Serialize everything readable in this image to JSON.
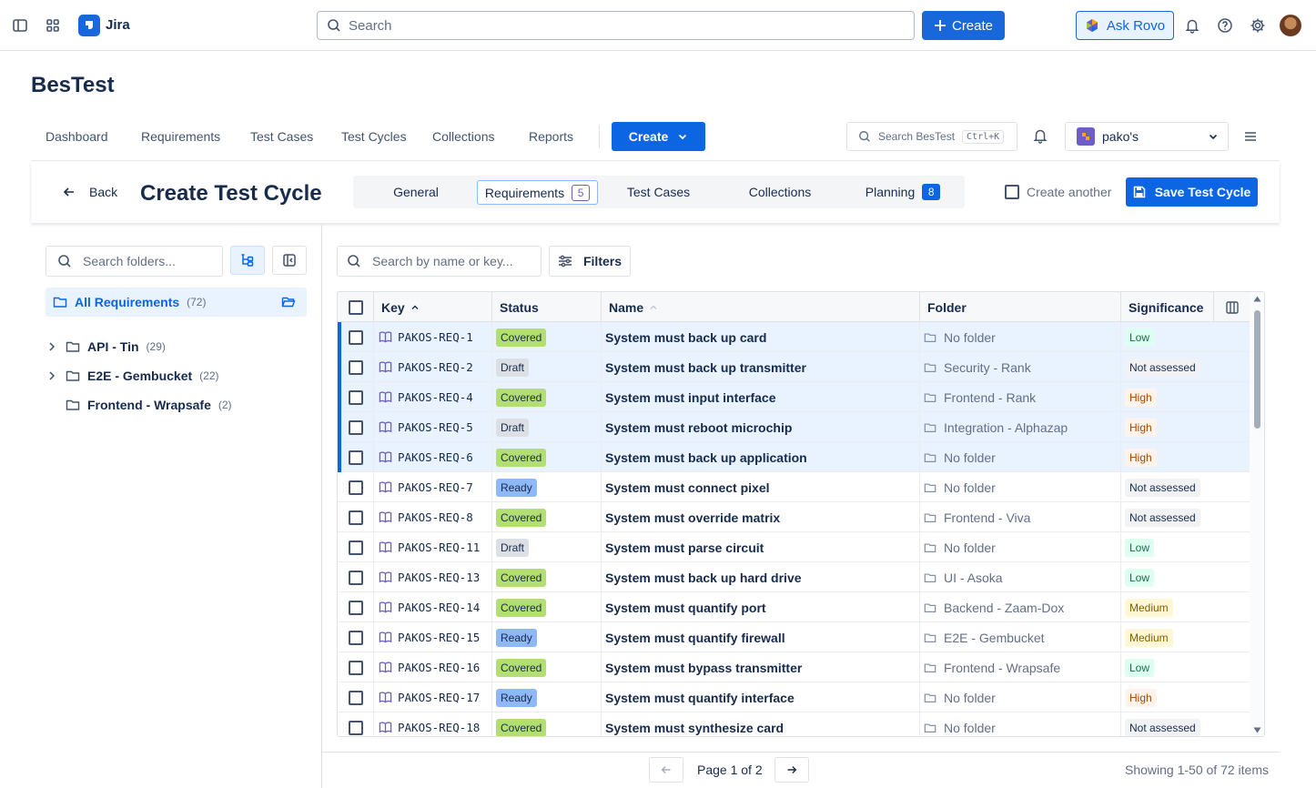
{
  "topbar": {
    "app_name": "Jira",
    "search_placeholder": "Search",
    "create_label": "Create",
    "rovo_label": "Ask Rovo"
  },
  "app": {
    "title": "BesTest",
    "nav": [
      "Dashboard",
      "Requirements",
      "Test Cases",
      "Test Cycles",
      "Collections",
      "Reports"
    ],
    "create_label": "Create",
    "search_placeholder": "Search BesTest",
    "search_shortcut": "Ctrl+K",
    "project_name": "pako's"
  },
  "create_bar": {
    "back_label": "Back",
    "title": "Create Test Cycle",
    "tabs": [
      {
        "label": "General",
        "count": ""
      },
      {
        "label": "Requirements",
        "count": "5"
      },
      {
        "label": "Test Cases",
        "count": ""
      },
      {
        "label": "Collections",
        "count": ""
      },
      {
        "label": "Planning",
        "count": "8"
      }
    ],
    "active_tab": "Requirements",
    "create_another_label": "Create another",
    "create_another_checked": false,
    "save_label": "Save Test Cycle"
  },
  "folders": {
    "search_placeholder": "Search folders...",
    "all": {
      "label": "All Requirements",
      "count": "(72)"
    },
    "items": [
      {
        "label": "API - Tin",
        "count": "(29)",
        "expandable": true
      },
      {
        "label": "E2E - Gembucket",
        "count": "(22)",
        "expandable": true
      },
      {
        "label": "Frontend - Wrapsafe",
        "count": "(2)",
        "expandable": false
      }
    ]
  },
  "list": {
    "search_placeholder": "Search by name or key...",
    "filters_label": "Filters",
    "columns": {
      "key": "Key",
      "status": "Status",
      "name": "Name",
      "folder": "Folder",
      "significance": "Significance"
    },
    "rows": [
      {
        "key": "PAKOS-REQ-1",
        "status": "Covered",
        "name": "System must back up card",
        "folder": "No folder",
        "significance": "Low",
        "selected": true
      },
      {
        "key": "PAKOS-REQ-2",
        "status": "Draft",
        "name": "System must back up transmitter",
        "folder": "Security - Rank",
        "significance": "Not assessed",
        "selected": true
      },
      {
        "key": "PAKOS-REQ-4",
        "status": "Covered",
        "name": "System must input interface",
        "folder": "Frontend - Rank",
        "significance": "High",
        "selected": true
      },
      {
        "key": "PAKOS-REQ-5",
        "status": "Draft",
        "name": "System must reboot microchip",
        "folder": "Integration - Alphazap",
        "significance": "High",
        "selected": true
      },
      {
        "key": "PAKOS-REQ-6",
        "status": "Covered",
        "name": "System must back up application",
        "folder": "No folder",
        "significance": "High",
        "selected": true
      },
      {
        "key": "PAKOS-REQ-7",
        "status": "Ready",
        "name": "System must connect pixel",
        "folder": "No folder",
        "significance": "Not assessed",
        "selected": false
      },
      {
        "key": "PAKOS-REQ-8",
        "status": "Covered",
        "name": "System must override matrix",
        "folder": "Frontend - Viva",
        "significance": "Not assessed",
        "selected": false
      },
      {
        "key": "PAKOS-REQ-11",
        "status": "Draft",
        "name": "System must parse circuit",
        "folder": "No folder",
        "significance": "Low",
        "selected": false
      },
      {
        "key": "PAKOS-REQ-13",
        "status": "Covered",
        "name": "System must back up hard drive",
        "folder": "UI - Asoka",
        "significance": "Low",
        "selected": false
      },
      {
        "key": "PAKOS-REQ-14",
        "status": "Covered",
        "name": "System must quantify port",
        "folder": "Backend - Zaam-Dox",
        "significance": "Medium",
        "selected": false
      },
      {
        "key": "PAKOS-REQ-15",
        "status": "Ready",
        "name": "System must quantify firewall",
        "folder": "E2E - Gembucket",
        "significance": "Medium",
        "selected": false
      },
      {
        "key": "PAKOS-REQ-16",
        "status": "Covered",
        "name": "System must bypass transmitter",
        "folder": "Frontend - Wrapsafe",
        "significance": "Low",
        "selected": false
      },
      {
        "key": "PAKOS-REQ-17",
        "status": "Ready",
        "name": "System must quantify interface",
        "folder": "No folder",
        "significance": "High",
        "selected": false
      },
      {
        "key": "PAKOS-REQ-18",
        "status": "Covered",
        "name": "System must synthesize card",
        "folder": "No folder",
        "significance": "Not assessed",
        "selected": false
      }
    ]
  },
  "pagination": {
    "page_label": "Page 1 of 2",
    "showing_label": "Showing 1-50 of 72 items"
  },
  "colors": {
    "primary": "#0c66e4",
    "status": {
      "Covered": "#b3df72",
      "Draft": "#dcdfe4",
      "Ready": "#8fb8f6"
    },
    "significance": {
      "Low": {
        "bg": "#dcfff1",
        "fg": "#216e4e"
      },
      "Not assessed": {
        "bg": "#f1f2f4",
        "fg": "#172b4d"
      },
      "High": {
        "bg": "#fff3eb",
        "fg": "#a54800"
      },
      "Medium": {
        "bg": "#fff7d6",
        "fg": "#7f5f01"
      }
    }
  },
  "icons": [
    "sidebar-toggle-icon",
    "app-switcher-icon",
    "jira-logo-icon",
    "search-icon",
    "plus-icon",
    "rovo-icon",
    "bell-icon",
    "help-icon",
    "gear-icon",
    "chevron-down-icon",
    "menu-icon",
    "arrow-left-icon",
    "save-icon",
    "tree-view-icon",
    "collapse-panel-icon",
    "folder-icon",
    "folder-open-icon",
    "chevron-right-icon",
    "filter-icon",
    "book-icon",
    "sort-asc-icon",
    "columns-icon",
    "arrow-right-icon"
  ]
}
